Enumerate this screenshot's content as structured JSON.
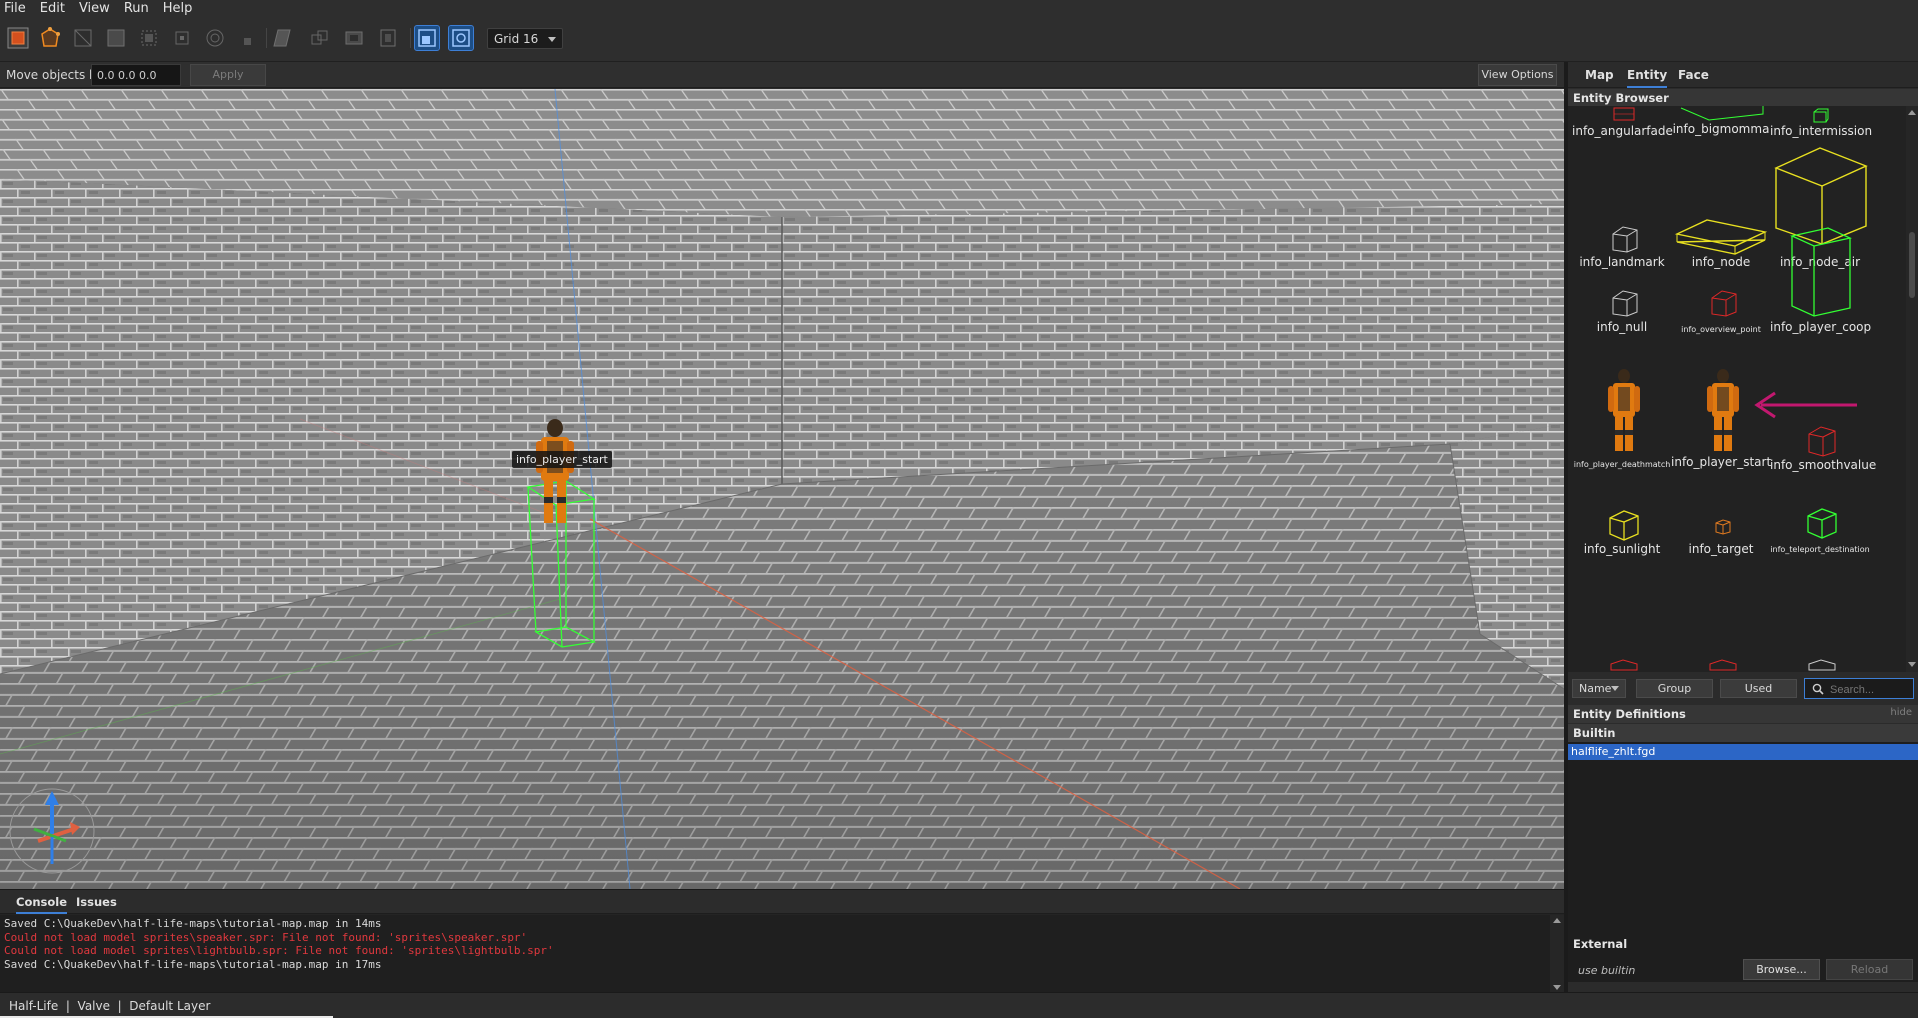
{
  "menu": [
    "File",
    "Edit",
    "View",
    "Run",
    "Help"
  ],
  "toolbar": {
    "grid_label": "Grid 16"
  },
  "movebar": {
    "label": "Move objects by",
    "value": "0.0 0.0 0.0",
    "apply_label": "Apply",
    "view_options_label": "View Options"
  },
  "viewport": {
    "entity_label": "info_player_start"
  },
  "panel": {
    "tabs": [
      "Map",
      "Entity",
      "Face"
    ],
    "active_tab": "Entity",
    "browser_title": "Entity Browser",
    "entities": [
      "info_angularfade",
      "info_bigmomma",
      "info_intermission",
      "info_landmark",
      "info_node",
      "info_node_air",
      "info_null",
      "info_overview_point",
      "info_player_coop",
      "info_player_deathmatch",
      "info_player_start",
      "info_smoothvalue",
      "info_sunlight",
      "info_target",
      "info_teleport_destination"
    ],
    "sort_label": "Name",
    "group_label": "Group",
    "used_label": "Used",
    "search_placeholder": "Search...",
    "definitions_title": "Entity Definitions",
    "hide_label": "hide",
    "builtin_label": "Builtin",
    "selected_definition": "halflife_zhlt.fgd",
    "external_label": "External",
    "use_builtin_label": "use builtin",
    "browse_label": "Browse...",
    "reload_label": "Reload"
  },
  "console": {
    "tabs": [
      "Console",
      "Issues"
    ],
    "lines": [
      {
        "text": "Saved C:\\QuakeDev\\half-life-maps\\tutorial-map.map in 14ms",
        "color": "#d8d8d8"
      },
      {
        "text": "Could not load model sprites\\speaker.spr: File not found: 'sprites\\speaker.spr'",
        "color": "#e0383e"
      },
      {
        "text": "Could not load model sprites\\lightbulb.spr: File not found: 'sprites\\lightbulb.spr'",
        "color": "#e0383e"
      },
      {
        "text": "Saved C:\\QuakeDev\\half-life-maps\\tutorial-map.map in 17ms",
        "color": "#d8d8d8"
      }
    ]
  },
  "status": {
    "text": "Half-Life  |  Valve  |  Default Layer"
  },
  "colors": {
    "accent": "#3d7fd6",
    "selection": "#2c66c6",
    "error": "#e0383e",
    "annotation_arrow": "#c2186f",
    "box_green": "#33ff33",
    "box_yellow": "#e8e020",
    "box_red": "#e02828",
    "box_white": "#cccccc",
    "box_orange": "#e07a20"
  },
  "icons": [
    "vertex-tool-icon",
    "edge-tool-icon",
    "brush-tool-icon",
    "clip-tool-icon",
    "rotate-tool-icon",
    "scale-tool-icon",
    "shear-tool-icon",
    "texture-lock-icon",
    "uv-lock-icon",
    "search-icon",
    "axis-gizmo-icon",
    "annotation-arrow-icon",
    "player-model-icon"
  ]
}
